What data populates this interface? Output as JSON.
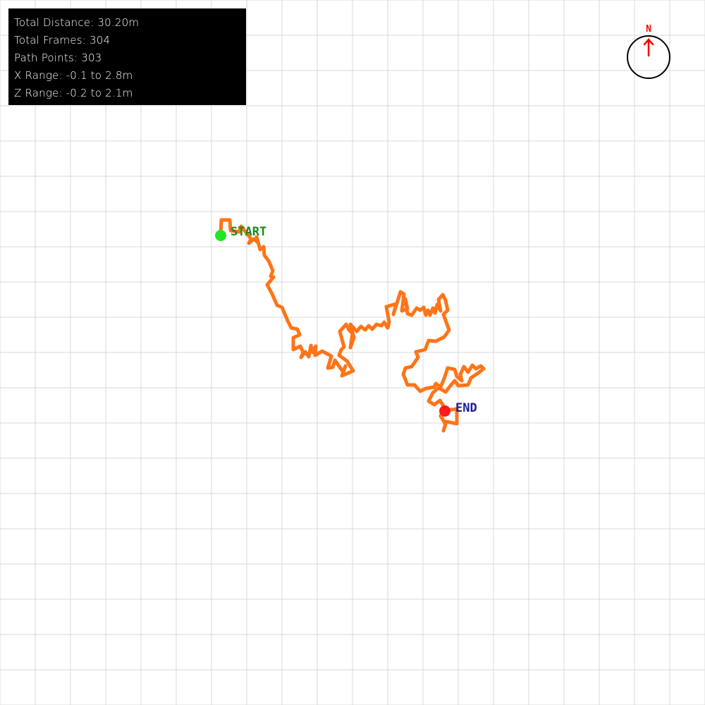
{
  "stats": {
    "total_distance": "Total Distance: 30.20m",
    "total_frames": "Total Frames: 304",
    "path_points": "Path Points: 303",
    "x_range": "X Range: -0.1 to 2.8m",
    "z_range": "Z Range: -0.2 to 2.1m"
  },
  "markers": {
    "start_label": "START",
    "end_label": "END"
  },
  "compass": {
    "north_label": "N"
  },
  "colors": {
    "grid": "#d9d9d9",
    "path": "#ff7417",
    "start_dot": "#22e622",
    "start_label": "#1a8a1a",
    "end_dot": "#ff1a1a",
    "end_label": "#1a1a9a",
    "compass_ring": "#000000",
    "compass_arrow": "#ff0000"
  }
}
